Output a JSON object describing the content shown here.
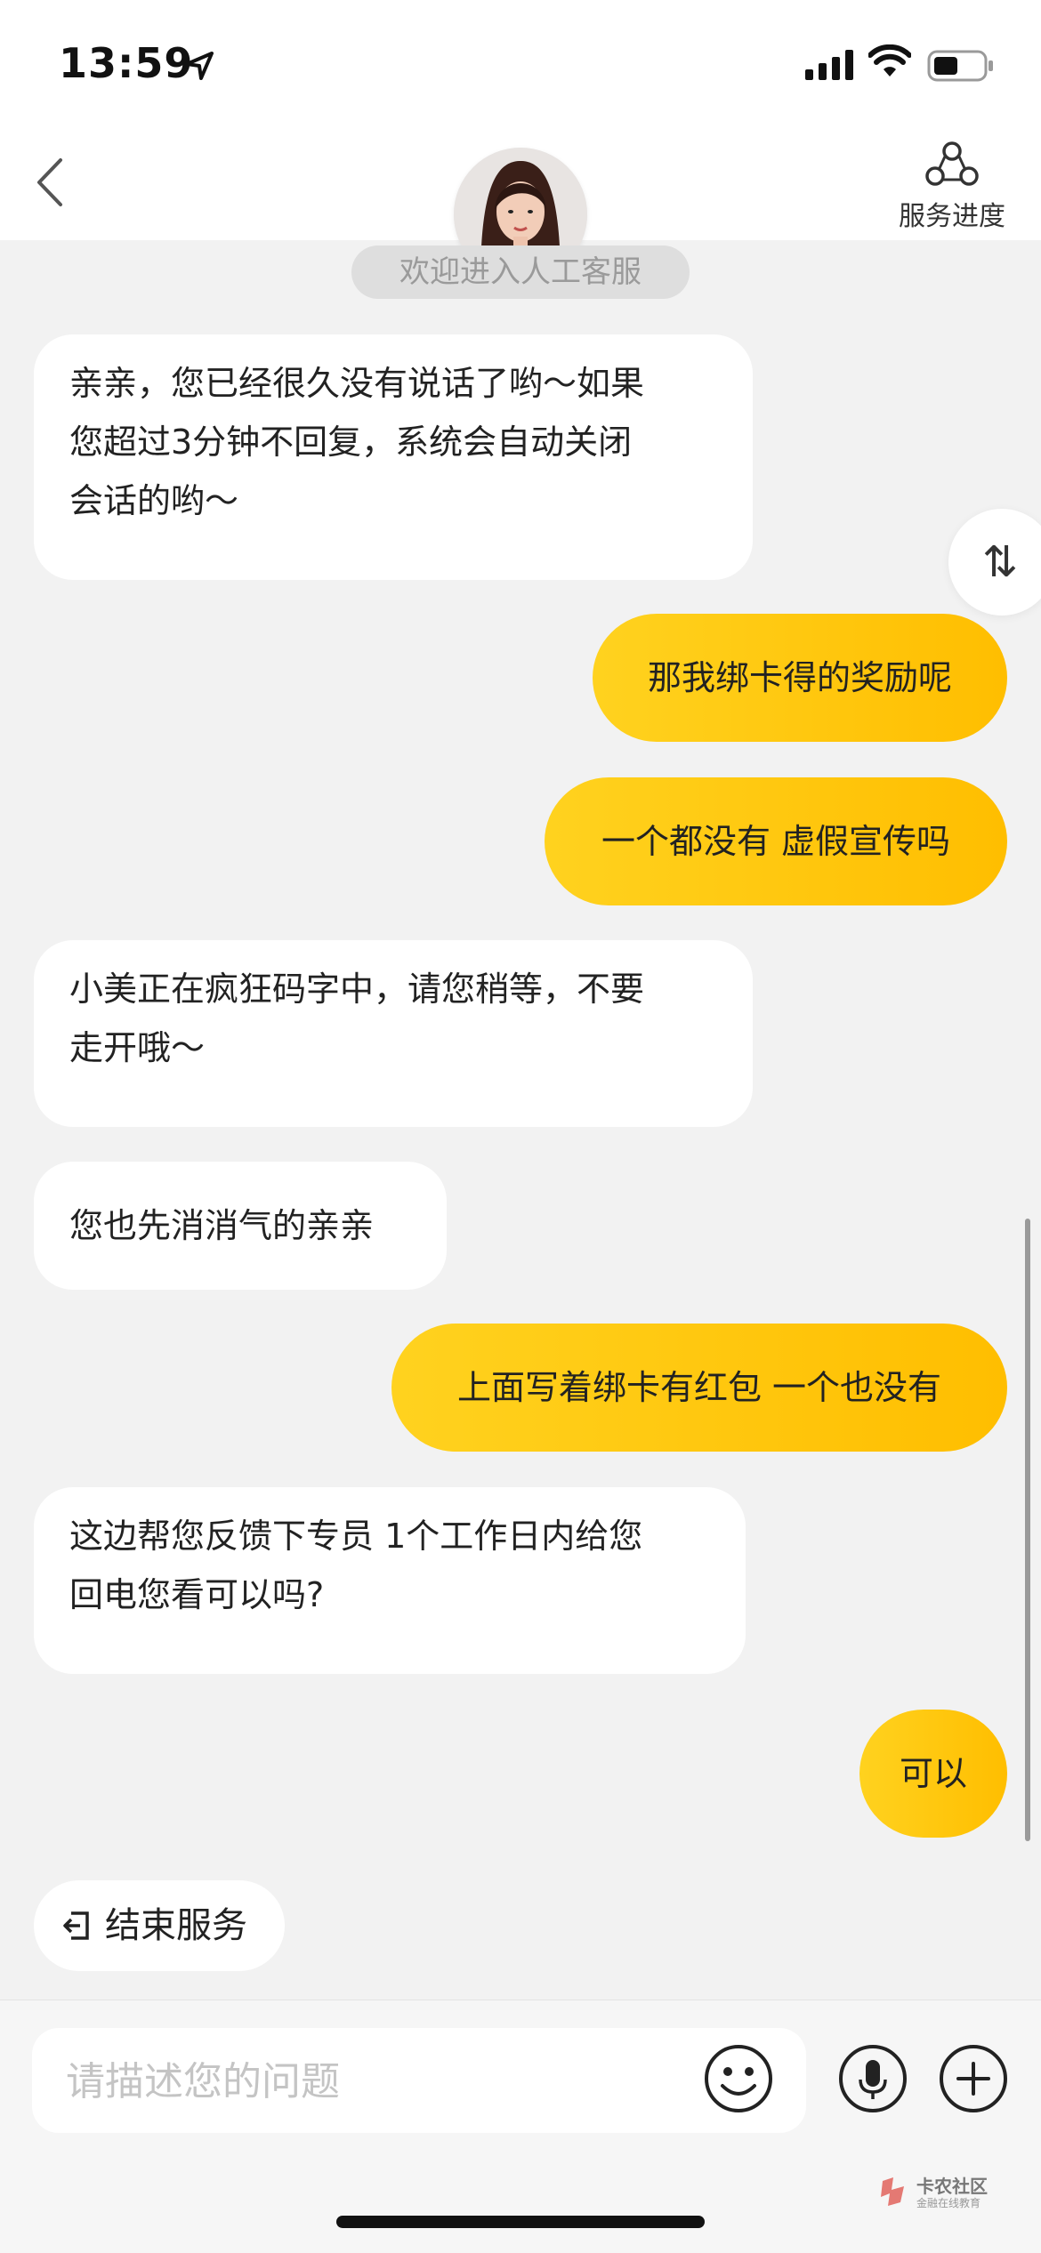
{
  "status_bar": {
    "time": "13:59"
  },
  "header": {
    "progress_label": "服务进度",
    "welcome_text": "欢迎进入人工客服"
  },
  "messages": [
    {
      "sender": "agent",
      "lines": [
        "亲亲，您已经很久没有说话了哟～如果",
        "您超过3分钟不回复，系统会自动关闭",
        "会话的哟～"
      ]
    },
    {
      "sender": "user",
      "text": "那我绑卡得的奖励呢"
    },
    {
      "sender": "user",
      "text": "一个都没有 虚假宣传吗"
    },
    {
      "sender": "agent",
      "lines": [
        "小美正在疯狂码字中，请您稍等，不要",
        "走开哦～"
      ]
    },
    {
      "sender": "agent",
      "lines": [
        "您也先消消气的亲亲"
      ]
    },
    {
      "sender": "user",
      "text": "上面写着绑卡有红包 一个也没有"
    },
    {
      "sender": "agent",
      "lines": [
        "这边帮您反馈下专员 1个工作日内给您",
        "回电您看可以吗?"
      ]
    },
    {
      "sender": "user",
      "text": "可以"
    }
  ],
  "side_toggle": {
    "label": "⇅"
  },
  "end_service": {
    "label": "结束服务"
  },
  "input": {
    "placeholder": "请描述您的问题",
    "value": ""
  },
  "watermark": {
    "title": "卡农社区",
    "subtitle": "金融在线教育"
  },
  "colors": {
    "user_bubble": "#ffc700",
    "agent_bubble": "#ffffff",
    "background": "#f2f2f2"
  },
  "icons": [
    "location-arrow-icon",
    "signal-icon",
    "wifi-icon",
    "battery-icon",
    "back-chevron-icon",
    "service-progress-icon",
    "sort-icon",
    "exit-icon",
    "emoji-icon",
    "microphone-icon",
    "plus-icon"
  ]
}
